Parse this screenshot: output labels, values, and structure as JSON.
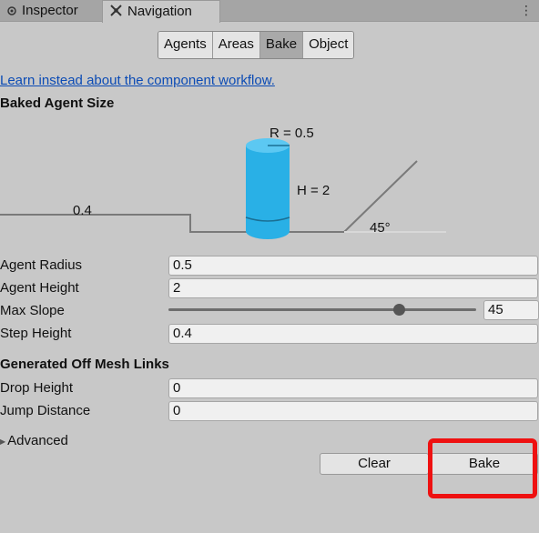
{
  "tabs": {
    "inspector": "Inspector",
    "navigation": "Navigation"
  },
  "segments": [
    "Agents",
    "Areas",
    "Bake",
    "Object"
  ],
  "selected_segment": "Bake",
  "link_text": "Learn instead about the component workflow.",
  "baked_agent_size": {
    "title": "Baked Agent Size",
    "radius_label": "R = 0.5",
    "height_label": "H = 2",
    "step_label": "0.4",
    "slope_label": "45°"
  },
  "fields": {
    "agent_radius": {
      "label": "Agent Radius",
      "value": "0.5"
    },
    "agent_height": {
      "label": "Agent Height",
      "value": "2"
    },
    "max_slope": {
      "label": "Max Slope",
      "value": "45"
    },
    "step_height": {
      "label": "Step Height",
      "value": "0.4"
    }
  },
  "slider": {
    "min": 0,
    "max": 60,
    "value": 45
  },
  "off_mesh": {
    "title": "Generated Off Mesh Links",
    "drop_height": {
      "label": "Drop Height",
      "value": "0"
    },
    "jump_distance": {
      "label": "Jump Distance",
      "value": "0"
    }
  },
  "advanced_label": "Advanced",
  "buttons": {
    "clear": "Clear",
    "bake": "Bake"
  },
  "colors": {
    "highlight": "#ee1111",
    "cylinder": "#29b0e6",
    "link": "#0b4bb5"
  }
}
